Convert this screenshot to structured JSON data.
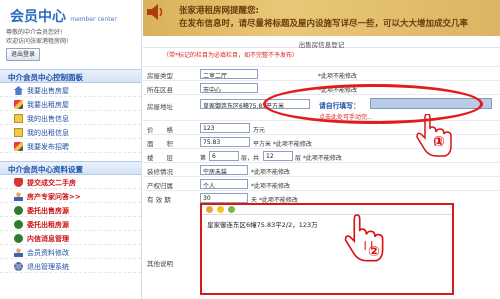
{
  "sidebar": {
    "logo_main": "会员中心",
    "logo_sub": "member center",
    "welcome_text": "尊敬的中介会员您好!",
    "welcome_sub": "欢迎访问张家港租房网!",
    "logout_label": "退出登录",
    "section1_title": "中介会员中心控制面板",
    "section1_items": [
      {
        "label": "我要出售房屋",
        "icon": "house-icon"
      },
      {
        "label": "我要出租房屋",
        "icon": "pen-icon"
      },
      {
        "label": "我的出售信息",
        "icon": "doc-icon"
      },
      {
        "label": "我的出租信息",
        "icon": "doc-icon"
      },
      {
        "label": "我要发布招聘",
        "icon": "pen-icon"
      }
    ],
    "section2_title": "中介会员中心资料设置",
    "section2_items": [
      {
        "label": "提交成交二手房",
        "icon": "shield-icon"
      },
      {
        "label": "房产专家问答>>",
        "icon": "person-icon"
      },
      {
        "label": "委托出售房源",
        "icon": "dot-icon"
      },
      {
        "label": "委托出租房源",
        "icon": "dot-icon"
      },
      {
        "label": "内信消息管理",
        "icon": "dot-icon"
      },
      {
        "label": "会员资料修改",
        "icon": "person-icon"
      },
      {
        "label": "退出管理系统",
        "icon": "gear-icon"
      }
    ]
  },
  "banner": {
    "line1": "张家港租房网提醒您:",
    "line2": "在发布信息时，请尽量将标题及屋内设施写详尽一些，可以大大增加成交几率"
  },
  "form": {
    "title": "出售房信息登记",
    "hint": "（带*标记的栏目为必填栏目，如不完整不予发布）",
    "fields": {
      "house_type": {
        "label": "房屋类型",
        "value": "二室二厅",
        "note": "*此项不能修改"
      },
      "district": {
        "label": "所在区县",
        "value": "市中心",
        "note": "*此项不能修改"
      },
      "address": {
        "label": "房屋地址",
        "value": "皇家御连东区6幢75.83平方米",
        "self_label": "请自行填写：",
        "link": "点击此处可手动完..."
      },
      "price": {
        "label": "价　　格",
        "value": "123",
        "unit": "万元"
      },
      "area": {
        "label": "面　　积",
        "value": "75.83",
        "note": "平方米 *此项不能修改"
      },
      "floor": {
        "label": "楼　　层",
        "prefix": "第",
        "value1": "6",
        "mid": "层，共",
        "value2": "12",
        "suffix": "层 *此项不能修改"
      },
      "decoration": {
        "label": "装修情况",
        "value": "空房未装",
        "note": "*此项不能修改"
      },
      "ownership": {
        "label": "产权归属",
        "value": "个人",
        "note": "*此项不能修改"
      },
      "validity": {
        "label": "有 效 期",
        "value": "30",
        "note": "天 *此项不能修改"
      },
      "description": {
        "label": "其他说明",
        "content": "皇家御连东区6幢75.83平2/2，123万"
      }
    }
  },
  "annotations": {
    "marker1": "①",
    "marker2": "②"
  },
  "colors": {
    "accent": "#1f4fa3",
    "highlight": "#e21b1b"
  }
}
